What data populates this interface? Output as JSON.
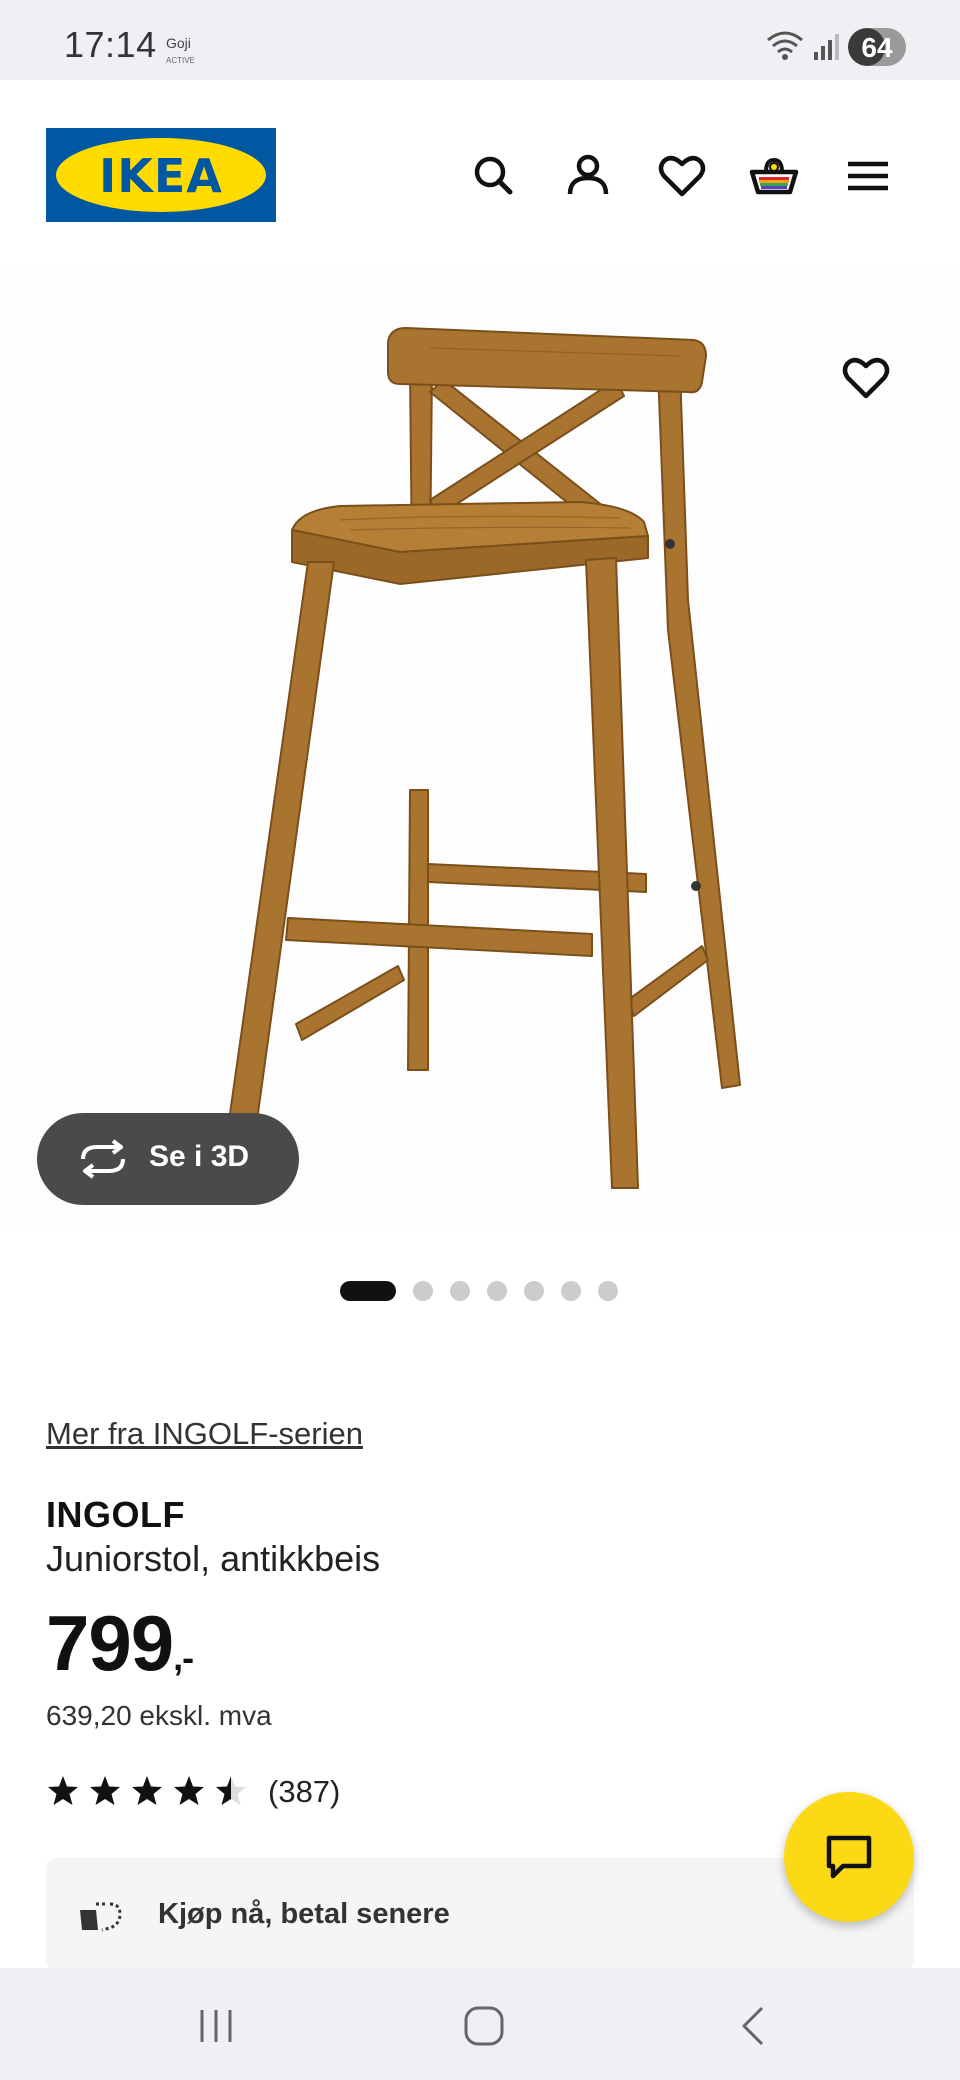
{
  "status_bar": {
    "time": "17:14",
    "goji_label": "Goji",
    "goji_sub": "ACTIVE",
    "battery": "64",
    "battery_level": 0.64
  },
  "header": {
    "logo_text": "IKEA",
    "icons": [
      "search-icon",
      "account-icon",
      "heart-icon",
      "basket-icon",
      "menu-icon"
    ]
  },
  "gallery": {
    "view_3d_label": "Se i 3D",
    "image_count": 7,
    "active_index": 0
  },
  "product": {
    "series_link": "Mer fra INGOLF-serien",
    "name": "INGOLF",
    "description": "Juniorstol, antikkbeis",
    "price_main": "799",
    "price_suffix": ",-",
    "price_ex_vat": "639,20 ekskl. mva",
    "rating": 4.5,
    "rating_max": 5,
    "review_count": "(387)"
  },
  "financing": {
    "label": "Kjøp nå, betal senere"
  },
  "colors": {
    "ikea_blue": "#0058a3",
    "ikea_yellow": "#ffdb00",
    "chat_yellow": "#fbd914",
    "wood": "#a9742f"
  }
}
